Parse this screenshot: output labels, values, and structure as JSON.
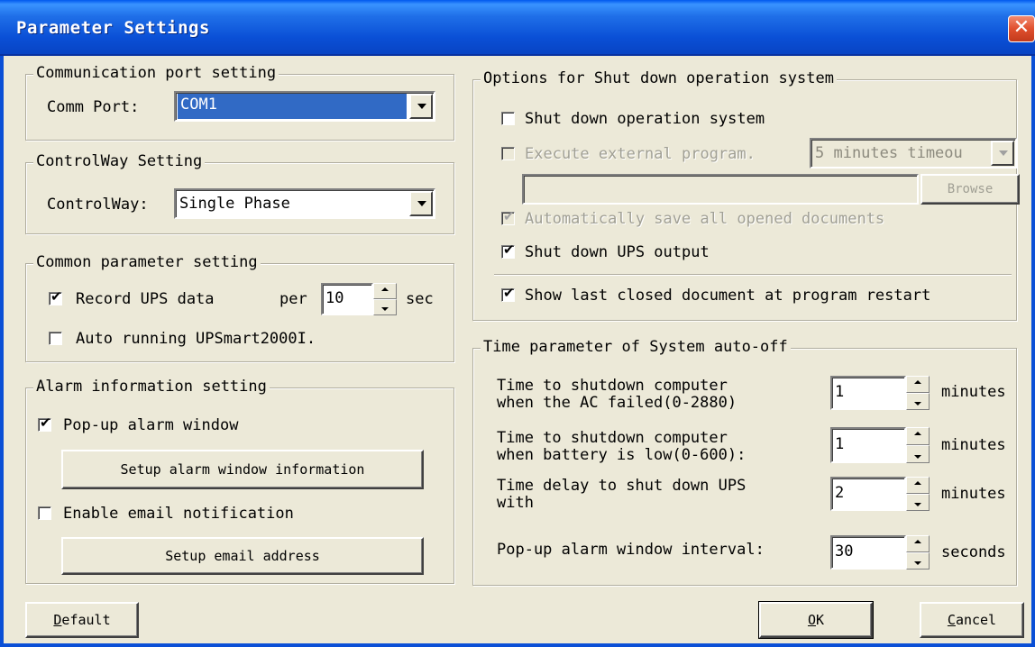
{
  "window": {
    "title": "Parameter Settings",
    "close_glyph": "✕"
  },
  "comm": {
    "legend": "Communication port setting",
    "label": "Comm Port:",
    "value": "COM1"
  },
  "control": {
    "legend": "ControlWay Setting",
    "label": "ControlWay:",
    "value": "Single Phase"
  },
  "common": {
    "legend": "Common parameter setting",
    "record_label": "Record UPS data",
    "record_checked": true,
    "per_label": "per",
    "per_value": "10",
    "sec_label": "sec",
    "auto_label": "Auto running UPSmart2000I.",
    "auto_checked": false
  },
  "alarm": {
    "legend": "Alarm information setting",
    "popup_label": "Pop-up alarm window",
    "popup_checked": true,
    "setup_window_button": "Setup alarm window information",
    "email_label": "Enable email notification",
    "email_checked": false,
    "setup_email_button": "Setup email address"
  },
  "shutdown": {
    "legend": "Options for Shut down operation system",
    "shutdown_os_label": "Shut down operation system",
    "shutdown_os_checked": false,
    "exec_label": "Execute external program.",
    "exec_checked": false,
    "timeout_value": "5 minutes timeou",
    "program_path": "",
    "browse_button": "Browse",
    "autosave_label": "Automatically save all opened documents",
    "autosave_checked": true,
    "shutdown_ups_label": "Shut down UPS output",
    "shutdown_ups_checked": true,
    "show_last_label": "Show last closed document at program restart",
    "show_last_checked": true
  },
  "time": {
    "legend": "Time parameter of System auto-off",
    "rows": [
      {
        "line1": "Time to shutdown computer",
        "line2": "when the AC failed(0-2880)",
        "value": "1",
        "unit": "minutes"
      },
      {
        "line1": "Time to shutdown computer",
        "line2": "when battery is low(0-600):",
        "value": "1",
        "unit": "minutes"
      },
      {
        "line1": "Time delay to shut down UPS",
        "line2": "with",
        "value": "2",
        "unit": "minutes"
      },
      {
        "line1": "Pop-up alarm window interval:",
        "line2": "",
        "value": "30",
        "unit": "seconds"
      }
    ]
  },
  "buttons": {
    "default_first": "D",
    "default_rest": "efault",
    "ok_first": "O",
    "ok_rest": "K",
    "cancel_first": "C",
    "cancel_rest": "ancel"
  }
}
